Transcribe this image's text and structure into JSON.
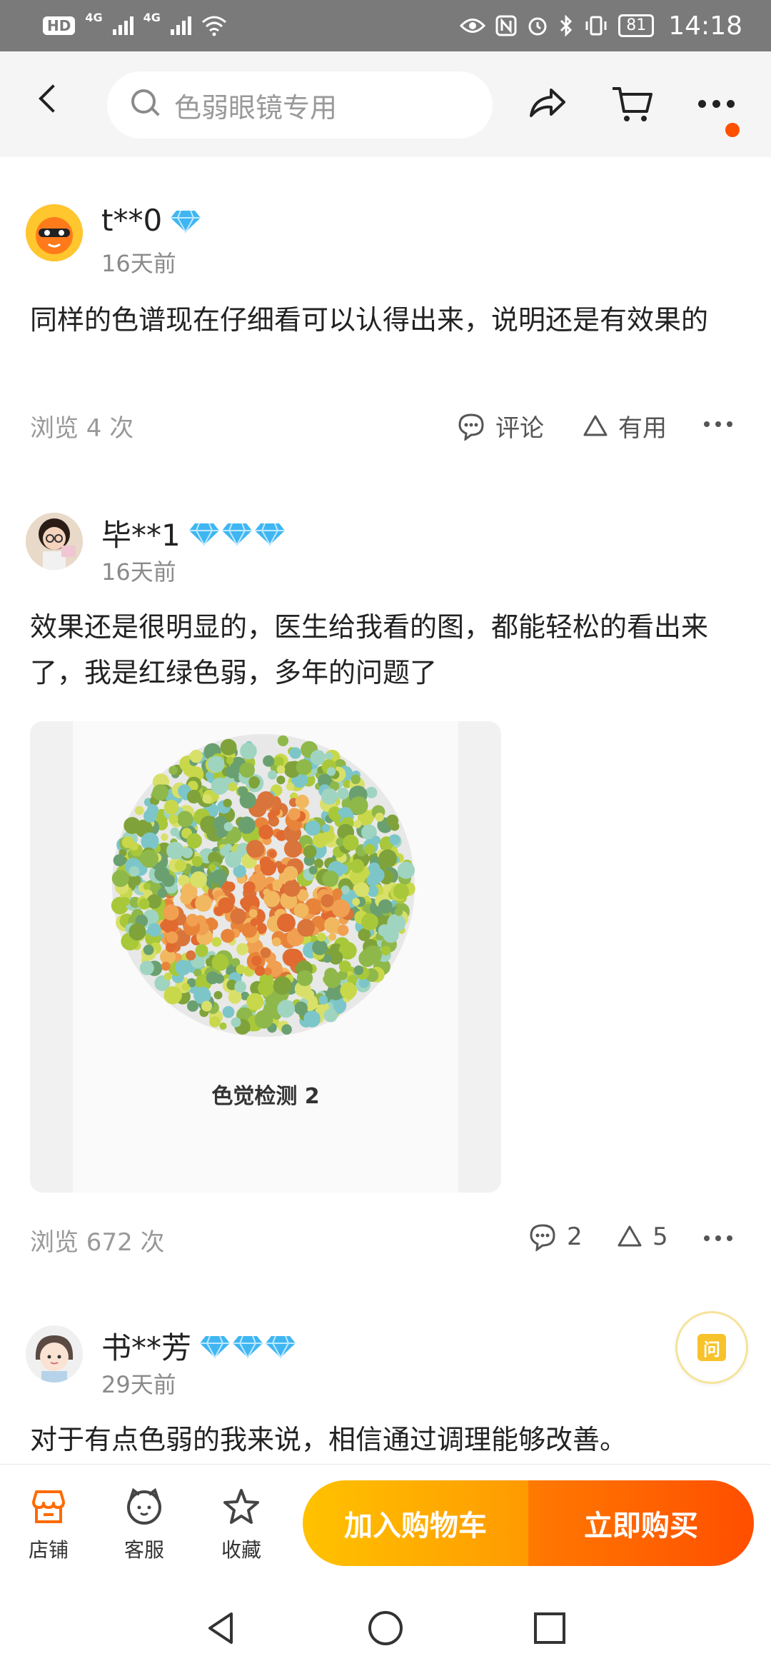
{
  "status_bar": {
    "hd_badge": "HD",
    "network_1": "4G",
    "network_2": "4G",
    "battery": "81",
    "time": "14:18",
    "icons": [
      "hd-icon",
      "signal-icon",
      "signal-icon",
      "wifi-icon",
      "eye-icon",
      "nfc-icon",
      "alarm-icon",
      "bluetooth-icon",
      "vibrate-icon",
      "battery-icon"
    ]
  },
  "topnav": {
    "search_placeholder": "色弱眼镜专用",
    "icons": [
      "back-icon",
      "search-icon",
      "share-icon",
      "cart-icon",
      "more-icon"
    ],
    "notification_color": "#ff5000"
  },
  "reviews": [
    {
      "username": "t**0",
      "diamonds": 1,
      "time": "16天前",
      "content": "同样的色谱现在仔细看可以认得出来，说明还是有效果的",
      "views": "浏览 4 次",
      "comment_label": "评论",
      "useful_label": "有用"
    },
    {
      "username": "毕**1",
      "diamonds": 3,
      "time": "16天前",
      "content": "效果还是很明显的，医生给我看的图，都能轻松的看出来了，我是红绿色弱，多年的问题了",
      "image_caption": "色觉检测 2",
      "views": "浏览 672 次",
      "comment_count": "2",
      "useful_count": "5"
    },
    {
      "username": "书**芳",
      "diamonds": 3,
      "time": "29天前",
      "content": "对于有点色弱的我来说，相信通过调理能够改善。"
    }
  ],
  "ask_button_label": "问",
  "bottom_bar": {
    "shop_label": "店铺",
    "service_label": "客服",
    "favorite_label": "收藏",
    "add_to_cart_label": "加入购物车",
    "buy_now_label": "立即购买",
    "accent": "#ff5000"
  }
}
